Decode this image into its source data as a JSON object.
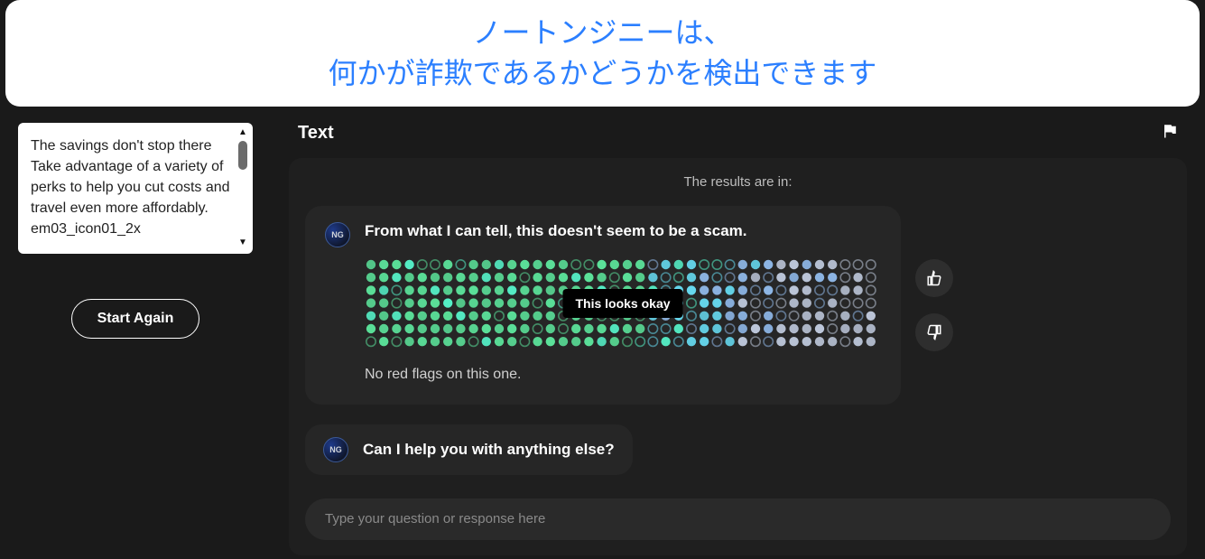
{
  "banner": {
    "line1": "ノートンジニーは、",
    "line2": "何かが詐欺であるかどうかを検出できます"
  },
  "sidebar": {
    "sample_text": "The savings don't stop there Take advantage of a variety of perks to help you cut costs and travel even more affordably. em03_icon01_2x",
    "start_again_label": "Start Again"
  },
  "main": {
    "title": "Text",
    "results_intro": "The results are in:",
    "avatar_initials": "NG",
    "result": {
      "headline": "From what I can tell, this doesn't seem to be a scam.",
      "overlay": "This looks okay",
      "subline": "No red flags on this one."
    },
    "followup": "Can I help you with anything else?",
    "input_placeholder": "Type your question or response here"
  },
  "colors": {
    "accent_blue": "#2b7fff",
    "band_green": "#5BE29A",
    "band_teal": "#55F0C7",
    "band_cyan": "#66D9EF",
    "band_blue": "#8FB8E8",
    "band_grey": "#BCC6D9"
  }
}
